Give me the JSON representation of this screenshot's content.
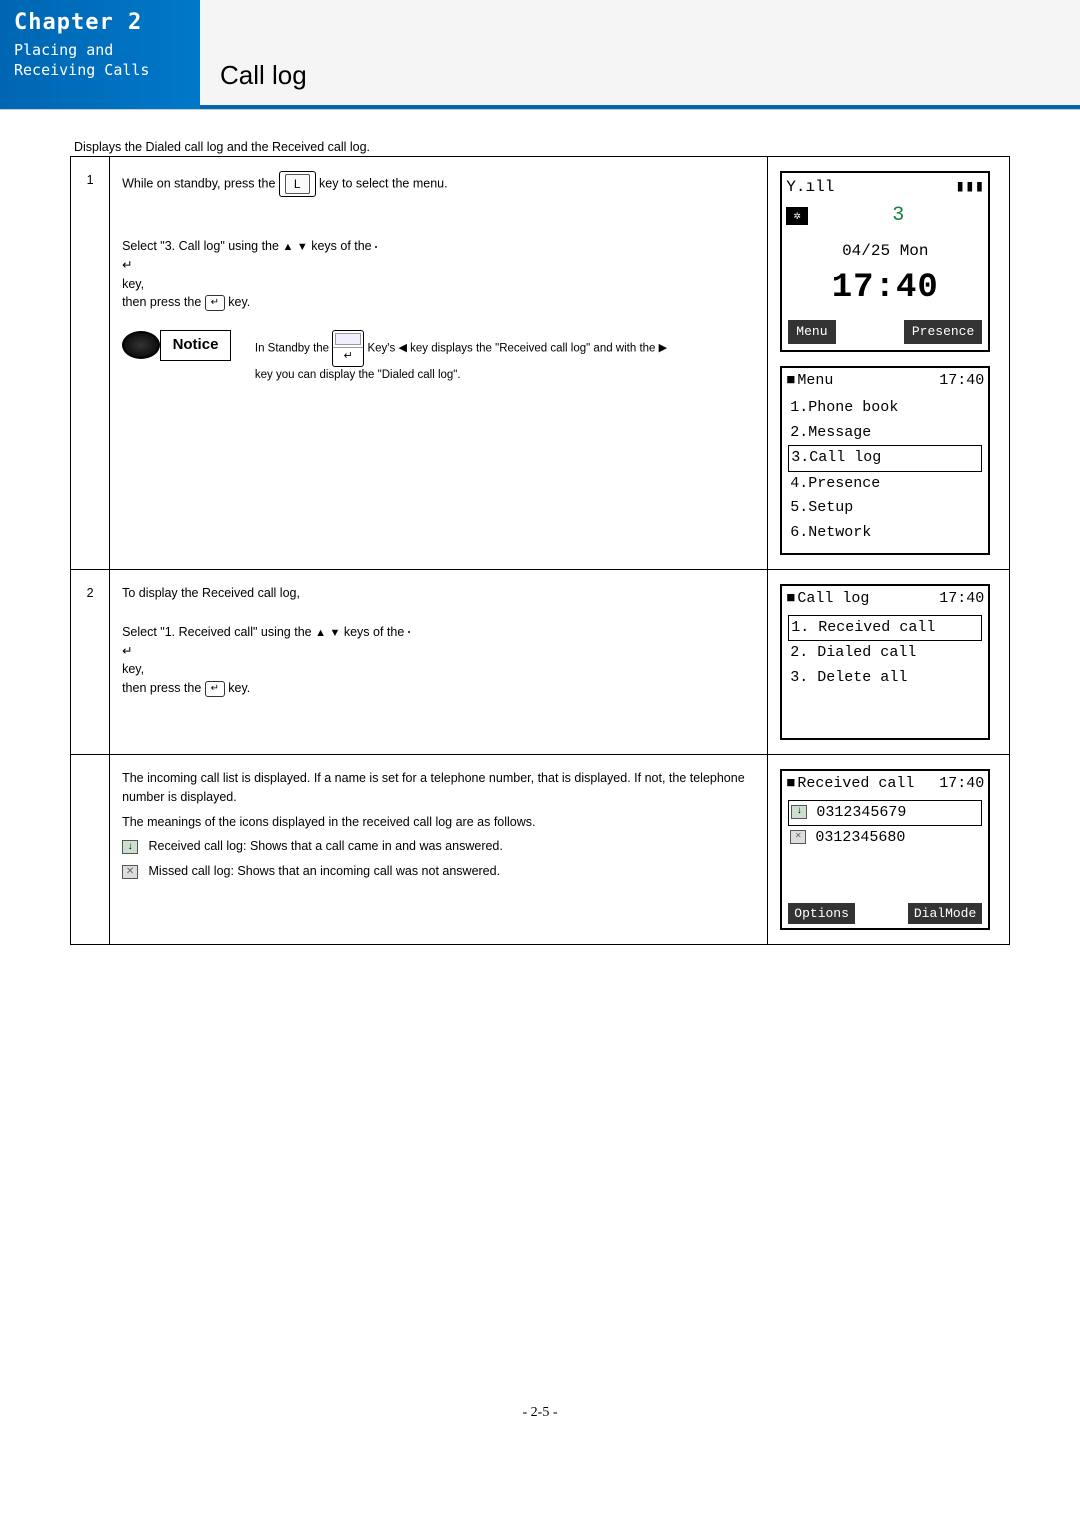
{
  "header": {
    "chapter": "Chapter 2",
    "subtitle1": "Placing and",
    "subtitle2": "Receiving Calls",
    "section_title": "Call log"
  },
  "intro": "Displays the Dialed call log and the Received call log.",
  "steps": {
    "1": "1",
    "2": "2"
  },
  "step1": {
    "line1_a": "While on standby, press the ",
    "line1_key": "L",
    "line1_b": " key to select the menu.",
    "line2_a": "Select \"3. Call log\" using the ",
    "line2_b": " keys of the ",
    "line2_c": " key,",
    "line3_a": "then press the ",
    "line3_b": " key.",
    "notice_label": "Notice",
    "notice_a": "In Standby the ",
    "notice_b": " Key's ",
    "notice_c": " key displays the \"Received call log\" and with the ",
    "notice_d": " key you can display the \"Dialed call log\"."
  },
  "step2": {
    "line1": "To display the Received call log,",
    "line2_a": "Select \"1. Received call\" using the ",
    "line2_b": " keys of the ",
    "line2_c": " key,",
    "line3_a": "then press the ",
    "line3_b": " key.",
    "para2": "The incoming call list is displayed. If a name is set for a telephone number, that is displayed. If not, the telephone number is displayed.",
    "para3": "The meanings of the icons displayed in the received call log are as follows.",
    "bullet1": "Received call log:  Shows that a call came in and was answered.",
    "bullet2": "Missed call log:  Shows that an incoming call was not answered."
  },
  "phone_standby": {
    "signal": "▼▂▄▆█",
    "signal_txt": "Y.ıll",
    "battery": "⏚",
    "num": "3",
    "date": "04/25 Mon",
    "time": "17:40",
    "softkey_left": "Menu",
    "softkey_right": "Presence"
  },
  "phone_menu": {
    "title": "Menu",
    "time": "17:40",
    "items": [
      "1.Phone book",
      "2.Message",
      "3.Call log",
      "4.Presence",
      "5.Setup",
      "6.Network"
    ],
    "selected_index": 2
  },
  "phone_calllog": {
    "title": "Call log",
    "time": "17:40",
    "items": [
      "1. Received call",
      "2. Dialed call",
      "3. Delete all"
    ],
    "selected_index": 0
  },
  "phone_received": {
    "title": "Received call",
    "time": "17:40",
    "rows": [
      {
        "icon": "↓",
        "num": "0312345679",
        "sel": true
      },
      {
        "icon": "✕",
        "num": "0312345680",
        "sel": false
      }
    ],
    "softkey_left": "Options",
    "softkey_right": "DialMode"
  },
  "page_footer": "- 2-5 -"
}
